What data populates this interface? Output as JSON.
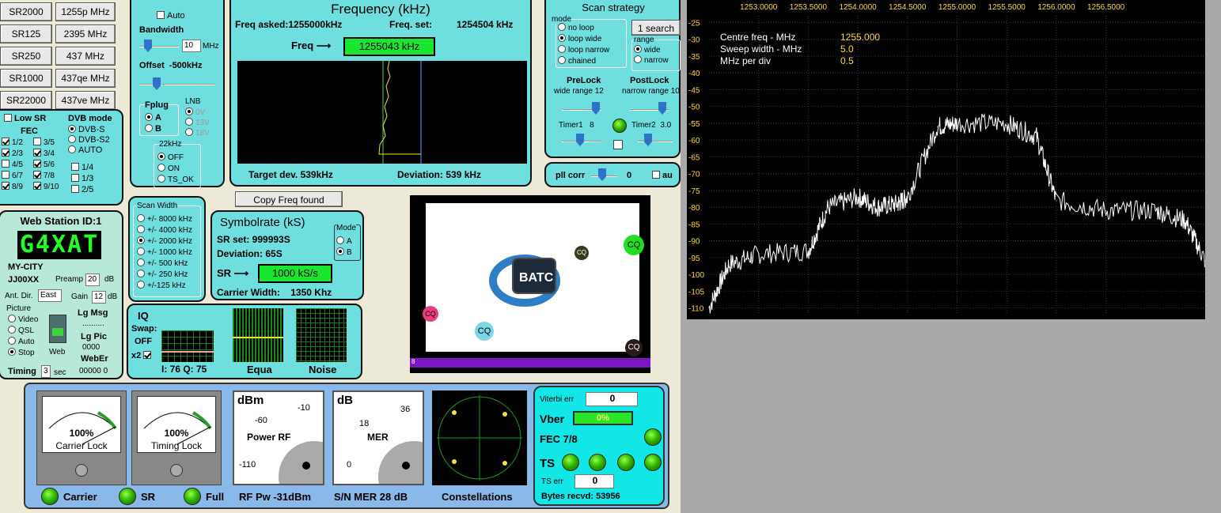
{
  "sr_buttons": [
    {
      "sr": "SR2000",
      "freq": "1255p MHz"
    },
    {
      "sr": "SR125",
      "freq": "2395 MHz"
    },
    {
      "sr": "SR250",
      "freq": "437 MHz"
    },
    {
      "sr": "SR1000",
      "freq": "437qe MHz"
    },
    {
      "sr": "SR22000",
      "freq": "437ve MHz"
    }
  ],
  "left": {
    "low_sr": "Low SR",
    "fec": "FEC",
    "dvb_mode": "DVB mode",
    "fec_items": [
      [
        "1/2",
        "3/5"
      ],
      [
        "2/3",
        "3/4"
      ],
      [
        "4/5",
        "5/6"
      ],
      [
        "6/7",
        "7/8"
      ],
      [
        "8/9",
        "9/10"
      ]
    ],
    "fec_extra": [
      "1/4",
      "1/3",
      "2/5"
    ],
    "dvb_items": [
      "DVB-S",
      "DVB-S2",
      "AUTO"
    ]
  },
  "tuner": {
    "auto": "Auto",
    "bandwidth": "Bandwidth",
    "bw_value": "10",
    "bw_unit": "MHz",
    "offset": "Offset",
    "offset_value": "-500kHz",
    "fplug": "Fplug",
    "fplug_a": "A",
    "fplug_b": "B",
    "lnb": "LNB",
    "lnb_items": [
      "0V",
      "13V",
      "18V"
    ],
    "k22": "22kHz",
    "k22_items": [
      "OFF",
      "ON",
      "TS_OK"
    ]
  },
  "freq": {
    "title": "Frequency (kHz)",
    "asked": "Freq asked:1255000kHz",
    "set_label": "Freq. set:",
    "set_value": "1254504 kHz",
    "freq_label": "Freq ⟶",
    "freq_value": "1255043 kHz",
    "target": "Target dev. 539kHz",
    "deviation": "Deviation: 539 kHz"
  },
  "copy_btn": "Copy Freq found",
  "scan": {
    "title": "Scan strategy",
    "mode": "mode",
    "modes": [
      "no loop",
      "loop wide",
      "loop narrow",
      "chained"
    ],
    "search_btn": "1 search",
    "range": "range",
    "ranges": [
      "wide",
      "narrow"
    ],
    "prelock": "PreLock",
    "prelock_sub": "wide range",
    "prelock_val": "12",
    "postlock": "PostLock",
    "postlock_sub": "narrow range",
    "postlock_val": "10",
    "timer1": "Timer1",
    "timer1_val": "8",
    "timer2": "Timer2",
    "timer2_val": "3.0"
  },
  "pll": {
    "label": "pll corr",
    "value": "0",
    "auto": "au"
  },
  "station": {
    "title": "Web Station ID:1",
    "callsign": "G4XAT",
    "city": "MY-CITY",
    "locator": "JJ00XX",
    "preamp": "Preamp",
    "preamp_val": "20",
    "db": "dB",
    "antdir": "Ant. Dir.",
    "antdir_val": "East",
    "gain": "Gain",
    "gain_val": "12",
    "picture": "Picture",
    "pic_items": [
      "Video",
      "QSL",
      "Auto",
      "Stop"
    ],
    "web": "Web",
    "lgmsg": "Lg Msg",
    "dots": "..........",
    "lgpic": "Lg Pic",
    "lgpic_val": "0000",
    "webber": "WebEr",
    "webber_val": "00000  0",
    "timing": "Timing",
    "timing_val": "3",
    "sec": "sec"
  },
  "scanwidth": {
    "title": "Scan Width",
    "items": [
      "+/- 8000 kHz",
      "+/- 4000 kHz",
      "+/- 2000 kHz",
      "+/- 1000 kHz",
      "+/- 500 kHz",
      "+/- 250 kHz",
      "+/-125 kHz"
    ]
  },
  "symbol": {
    "title": "Symbolrate (kS)",
    "srset": "SR set:  999993S",
    "dev": "Deviation: 65S",
    "sr_label": "SR ⟶",
    "sr_value": "1000 kS/s",
    "cw_label": "Carrier Width:",
    "cw_value": "1350 Khz",
    "mode": "Mode",
    "mode_a": "A",
    "mode_b": "B"
  },
  "iq": {
    "title": "IQ",
    "swap": "Swap:",
    "swap_val": "OFF",
    "x2": "x2",
    "iq_val": "I: 76 Q: 75",
    "equa": "Equa",
    "noise": "Noise"
  },
  "video": {
    "cq": "CQ",
    "batc": "BATC",
    "bottom": "8"
  },
  "meters": {
    "carrier_pct": "100%",
    "carrier": "Carrier Lock",
    "timing_pct": "100%",
    "timing": "Timing Lock",
    "dbm": "dBm",
    "dbm_ticks": [
      "-60",
      "-10",
      "-110"
    ],
    "power": "Power RF",
    "db": "dB",
    "db_ticks": [
      "18",
      "36",
      "0"
    ],
    "mer": "MER",
    "constellations": "Constellations"
  },
  "status": {
    "carrier": "Carrier",
    "sr": "SR",
    "full": "Full",
    "rfpw": "RF Pw  -31dBm",
    "snmer": "S/N MER  28 dB",
    "viterbi": "Viterbi err",
    "viterbi_val": "0",
    "vber": "Vber",
    "vber_val": "0%",
    "fec": "FEC 7/8",
    "ts": "TS",
    "tserr": "TS err",
    "tserr_val": "0",
    "bytes": "Bytes recvd:  53956"
  },
  "spectrum": {
    "xticks": [
      "1253.0000",
      "1253.5000",
      "1254.0000",
      "1254.5000",
      "1255.0000",
      "1255.5000",
      "1256.0000",
      "1256.5000"
    ],
    "yticks": [
      "-25",
      "-30",
      "-35",
      "-40",
      "-45",
      "-50",
      "-55",
      "-60",
      "-65",
      "-70",
      "-75",
      "-80",
      "-85",
      "-90",
      "-95",
      "-100",
      "-105",
      "-110"
    ],
    "info": [
      {
        "k": "Centre freq - MHz",
        "v": "1255.000"
      },
      {
        "k": "Sweep width - MHz",
        "v": "5.0"
      },
      {
        "k": "MHz per div",
        "v": "0.5"
      }
    ]
  },
  "chart_data": {
    "type": "line",
    "x": [
      1252.5,
      1252.7,
      1253.0,
      1253.5,
      1253.7,
      1254.0,
      1254.2,
      1254.4,
      1254.5,
      1254.8,
      1255.0,
      1255.5,
      1255.8,
      1256.0,
      1256.5,
      1257.0,
      1257.3,
      1257.5
    ],
    "values": [
      -110,
      -97,
      -94,
      -93,
      -80,
      -77,
      -80,
      -79,
      -77,
      -56,
      -55,
      -55,
      -59,
      -78,
      -81,
      -81,
      -84,
      -96
    ],
    "xlim": [
      1252.5,
      1257.5
    ],
    "ylim": [
      -112,
      -23
    ],
    "xlabel": "",
    "ylabel": ""
  }
}
